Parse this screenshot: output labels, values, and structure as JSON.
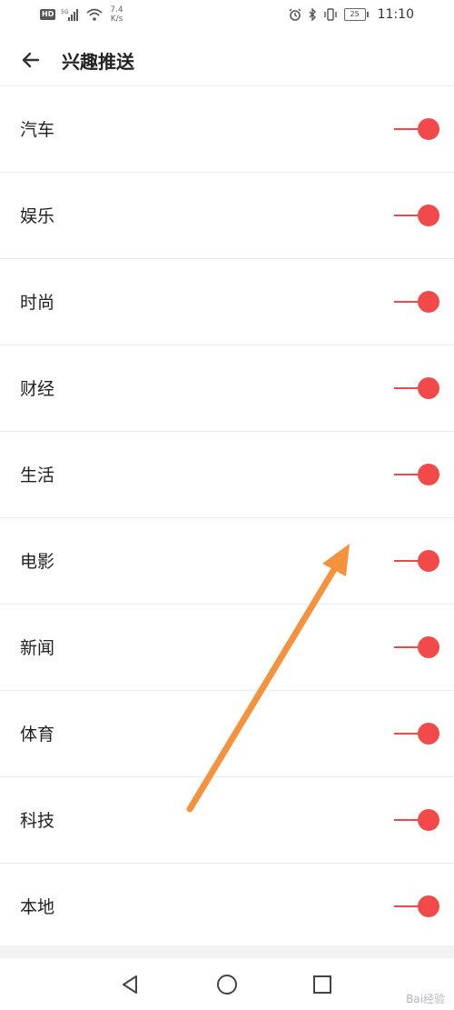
{
  "status_bar": {
    "hd_badge": "HD",
    "signal_label": "5G",
    "speed_value": "7.4",
    "speed_unit": "K/s",
    "battery": "25",
    "time": "11:10"
  },
  "header": {
    "title": "兴趣推送"
  },
  "items": [
    {
      "label": "汽车",
      "enabled": true
    },
    {
      "label": "娱乐",
      "enabled": true
    },
    {
      "label": "时尚",
      "enabled": true
    },
    {
      "label": "财经",
      "enabled": true
    },
    {
      "label": "生活",
      "enabled": true
    },
    {
      "label": "电影",
      "enabled": true
    },
    {
      "label": "新闻",
      "enabled": true
    },
    {
      "label": "体育",
      "enabled": true
    },
    {
      "label": "科技",
      "enabled": true
    },
    {
      "label": "本地",
      "enabled": true
    }
  ],
  "colors": {
    "toggle_on": "#f24a4a",
    "annotation_arrow": "#f5923e"
  },
  "watermark": "Bai经验"
}
